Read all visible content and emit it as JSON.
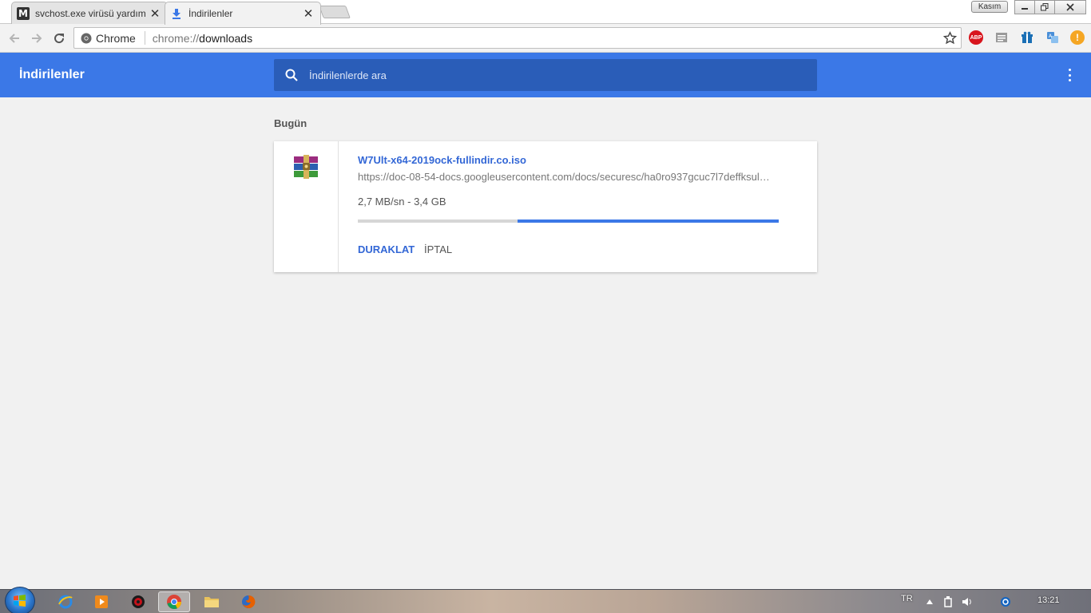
{
  "browser": {
    "tabs": [
      {
        "title": "svchost.exe virüsü yardım",
        "favicon": "medium-m-icon",
        "active": false
      },
      {
        "title": "İndirilenler",
        "favicon": "download-icon",
        "active": true
      }
    ],
    "window_user_label": "Kasım",
    "omnibox": {
      "site_label": "Chrome",
      "url_scheme": "chrome://",
      "url_path": "downloads"
    },
    "extensions": [
      "adblock-plus-icon",
      "reader-icon",
      "gift-icon",
      "translate-icon",
      "warning-icon"
    ],
    "extension_labels": {
      "abp": "ABP",
      "warn": "!"
    }
  },
  "downloads_page": {
    "title": "İndirilenler",
    "search_placeholder": "İndirilenlerde ara",
    "section_label": "Bugün",
    "items": [
      {
        "file_name": "W7Ult-x64-2019ock-fullindir.co.iso",
        "url": "https://doc-08-54-docs.googleusercontent.com/docs/securesc/ha0ro937gcuc7l7deffksul…",
        "status": "2,7 MB/sn - 3,4 GB",
        "progress_start": 0.38,
        "progress_end": 1.0,
        "pause_label": "DURAKLAT",
        "cancel_label": "İPTAL",
        "icon": "winrar-archive-icon"
      }
    ]
  },
  "colors": {
    "header_blue": "#3b78e7",
    "search_blue": "#2a5db8",
    "link_blue": "#3367d6"
  },
  "taskbar": {
    "apps": [
      "internet-explorer-icon",
      "media-player-icon",
      "antivirus-icon",
      "chrome-icon",
      "explorer-folder-icon",
      "firefox-icon"
    ],
    "language": "TR",
    "clock": "13:21"
  }
}
